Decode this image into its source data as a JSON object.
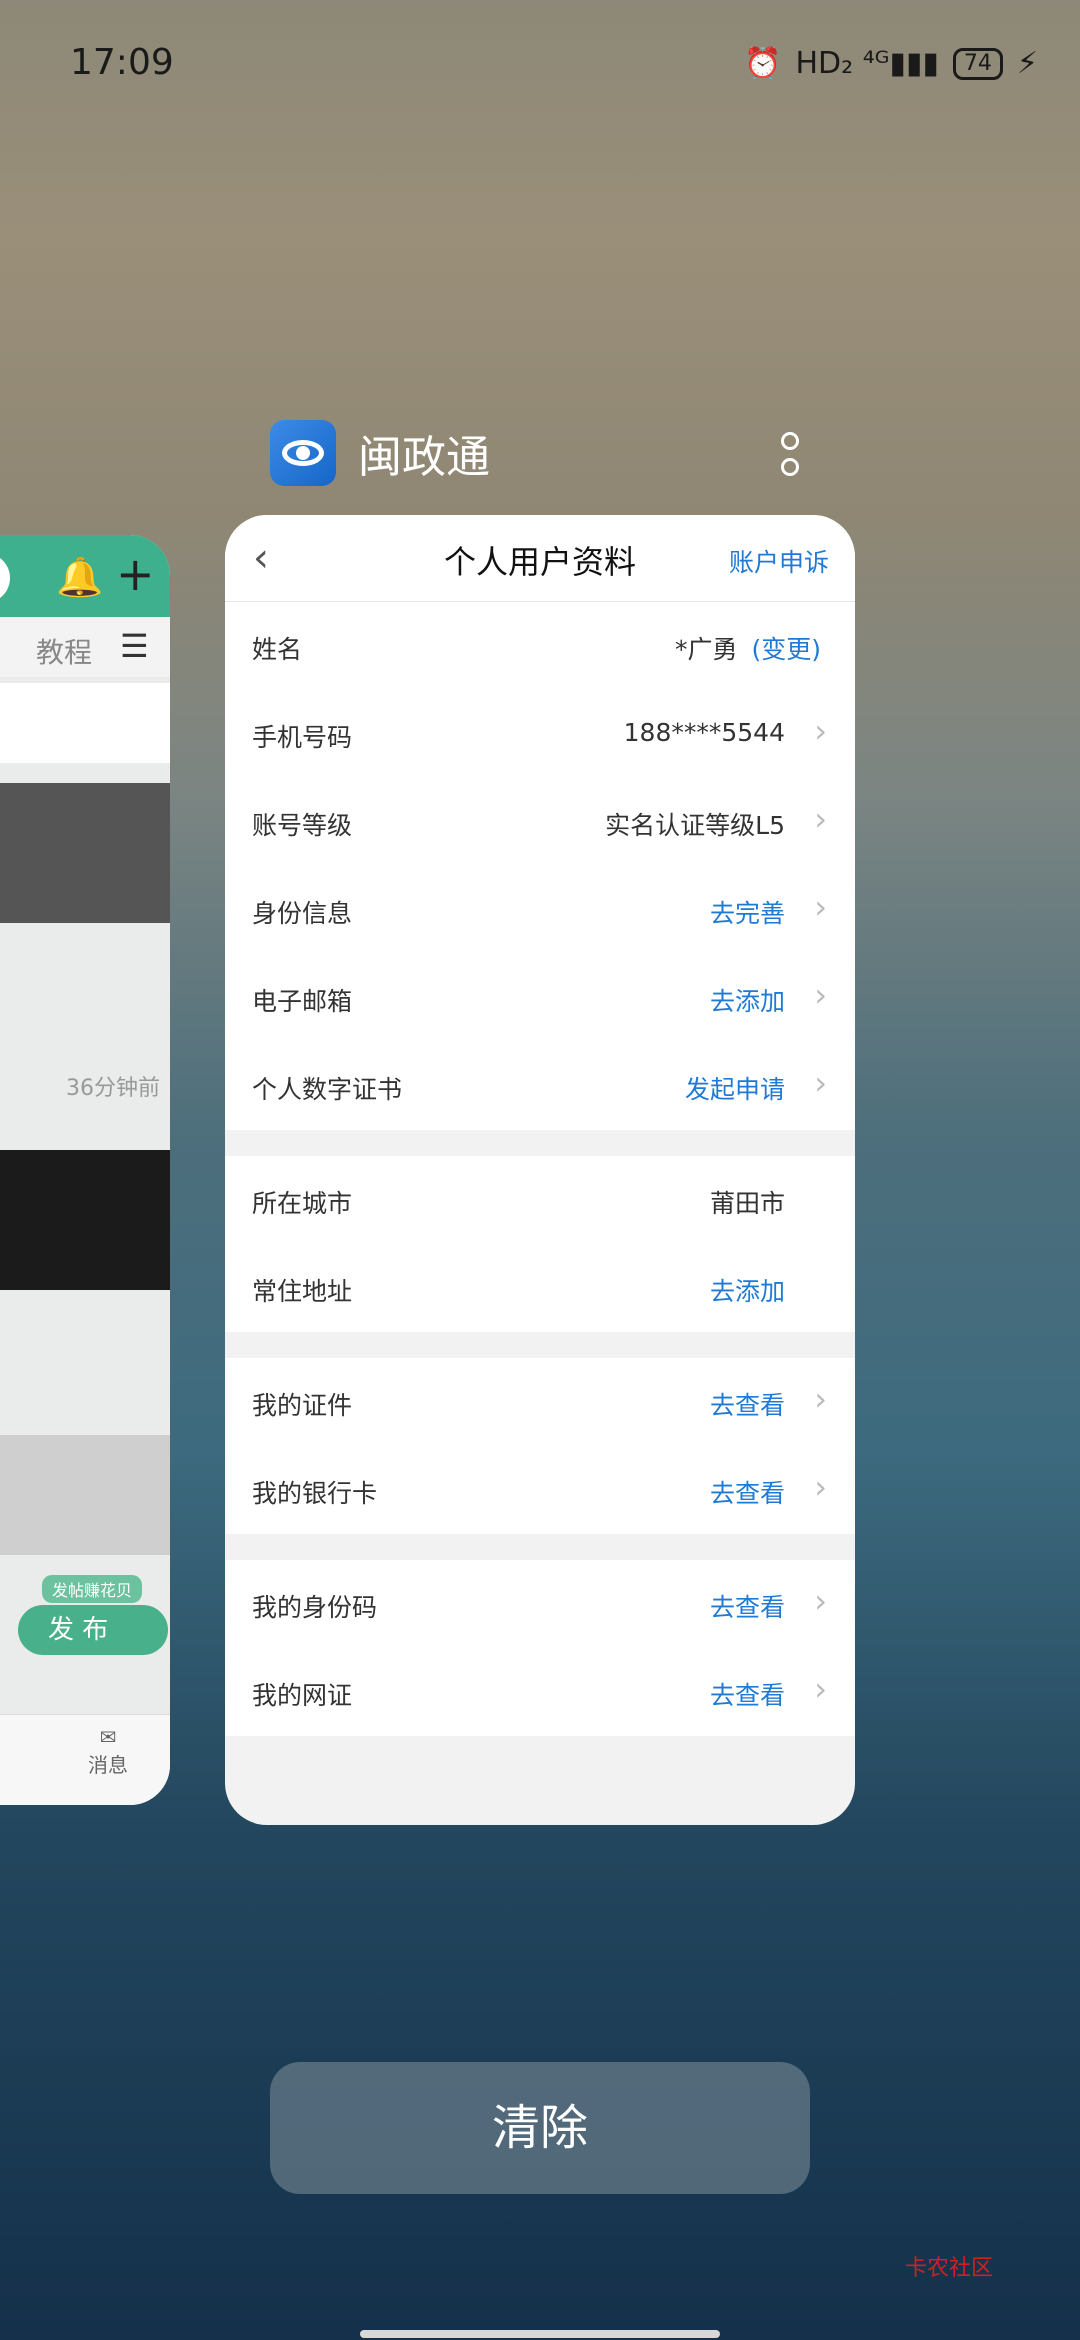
{
  "status": {
    "time": "17:09",
    "network": "HD₂ ⁴ᴳ▮▮▮",
    "battery": "74"
  },
  "left_app": {
    "tab": "教程",
    "timestamp": "36分钟前",
    "publish_tag": "发帖赚花贝",
    "publish_label": "发 布",
    "nav_label": "消息"
  },
  "app": {
    "name": "闽政通"
  },
  "page": {
    "back": "‹",
    "title": "个人用户资料",
    "appeal": "账户申诉"
  },
  "groups": [
    [
      {
        "label": "姓名",
        "value": "*广勇",
        "extra": "(变更)"
      },
      {
        "label": "手机号码",
        "value": "188****5544"
      },
      {
        "label": "账号等级",
        "value": "实名认证等级L5"
      },
      {
        "label": "身份信息",
        "value": "去完善"
      },
      {
        "label": "电子邮箱",
        "value": "去添加"
      },
      {
        "label": "个人数字证书",
        "value": "发起申请"
      }
    ],
    [
      {
        "label": "所在城市",
        "value": "莆田市"
      },
      {
        "label": "常住地址",
        "value": "去添加"
      }
    ],
    [
      {
        "label": "我的证件",
        "value": "去查看"
      },
      {
        "label": "我的银行卡",
        "value": "去查看"
      }
    ],
    [
      {
        "label": "我的身份码",
        "value": "去查看"
      },
      {
        "label": "我的网证",
        "value": "去查看"
      }
    ]
  ],
  "actions": {
    "clear": "清除"
  },
  "watermark": "卡农社区"
}
